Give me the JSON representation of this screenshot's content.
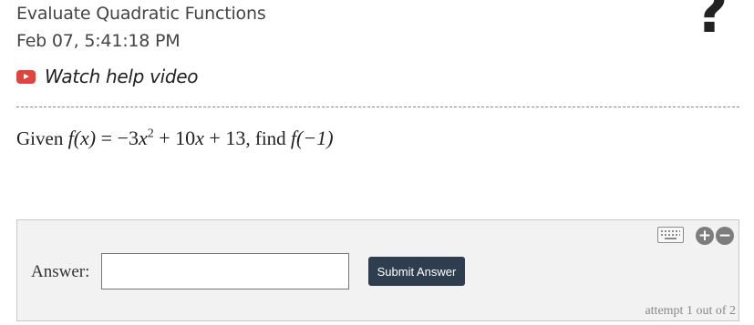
{
  "header": {
    "title": "Evaluate Quadratic Functions",
    "timestamp": "Feb 07, 5:41:18 PM",
    "help_icon_glyph": "?"
  },
  "video": {
    "icon": "youtube-play-icon",
    "link_text": "Watch help video"
  },
  "question": {
    "prefix": "Given",
    "function_lhs": "f(x)",
    "function_rhs_parts": [
      "−3",
      "x",
      "2",
      " + 10",
      "x",
      " + 13"
    ],
    "mid": ", find",
    "target": "f(−1)"
  },
  "answer_panel": {
    "label": "Answer:",
    "input_value": "",
    "input_placeholder": "",
    "submit_label": "Submit Answer",
    "attempt_text": "attempt 1 out of 2",
    "icons": [
      "keyboard-icon",
      "plus-circle-icon",
      "minus-circle-icon"
    ]
  },
  "colors": {
    "submit_bg": "#2f3e4e",
    "youtube_red": "#e0443e",
    "panel_bg": "#f2f2f2"
  }
}
